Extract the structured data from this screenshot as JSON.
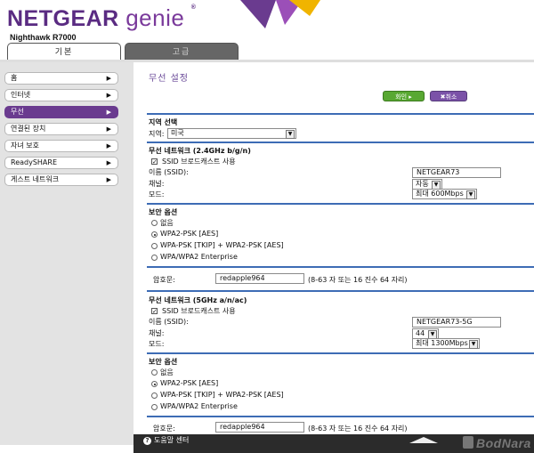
{
  "brand": {
    "netgear": "NETGEAR",
    "genie": "genie",
    "tm": "®",
    "router_model": "Nighthawk R7000"
  },
  "tabs": [
    {
      "label": "기본"
    },
    {
      "label": "고급"
    }
  ],
  "sidebar": {
    "items": [
      {
        "label": "홈"
      },
      {
        "label": "인터넷"
      },
      {
        "label": "무선"
      },
      {
        "label": "연결된 장치"
      },
      {
        "label": "자녀 보호"
      },
      {
        "label": "ReadySHARE"
      },
      {
        "label": "게스트 네트워크"
      }
    ],
    "arrow": "▶"
  },
  "page": {
    "title": "무선 설정",
    "apply_label": "화인 ▸",
    "cancel_label": "✖취소"
  },
  "region": {
    "heading": "지역 선택",
    "label": "지역:",
    "value": "미국"
  },
  "net24": {
    "heading": "무선 네트워크 (2.4GHz b/g/n)",
    "ssid_broadcast_label": "SSID 브로드캐스트 사용",
    "name_label": "이름 (SSID):",
    "name_value": "NETGEAR73",
    "channel_label": "채널:",
    "channel_value": "자동",
    "mode_label": "모드:",
    "mode_value": "최대 600Mbps",
    "security_heading": "보안 옵션",
    "options": [
      "없음",
      "WPA2-PSK [AES]",
      "WPA-PSK [TKIP] + WPA2-PSK [AES]",
      "WPA/WPA2 Enterprise"
    ],
    "passphrase_label": "암호문:",
    "passphrase_value": "redapple964",
    "passphrase_hint": "(8-63 자 또는 16 진수 64 자리)"
  },
  "net5": {
    "heading": "무선 네트워크 (5GHz a/n/ac)",
    "ssid_broadcast_label": "SSID 브로드캐스트 사용",
    "name_label": "이름 (SSID):",
    "name_value": "NETGEAR73-5G",
    "channel_label": "채널:",
    "channel_value": "44",
    "mode_label": "모드:",
    "mode_value": "최대 1300Mbps",
    "security_heading": "보안 옵션",
    "options": [
      "없음",
      "WPA2-PSK [AES]",
      "WPA-PSK [TKIP] + WPA2-PSK [AES]",
      "WPA/WPA2 Enterprise"
    ],
    "passphrase_label": "암호문:",
    "passphrase_value": "redapple964",
    "passphrase_hint": "(8-63 자 또는 16 진수 64 자리)"
  },
  "footer": {
    "help_label": "도움말 센터",
    "help_icon": "?"
  },
  "watermark": "BodNara",
  "colors": {
    "brand_purple": "#5a2b82",
    "accent_blue": "#3d6cb5",
    "apply_green": "#58a832",
    "cancel_purple": "#7b52a8"
  }
}
